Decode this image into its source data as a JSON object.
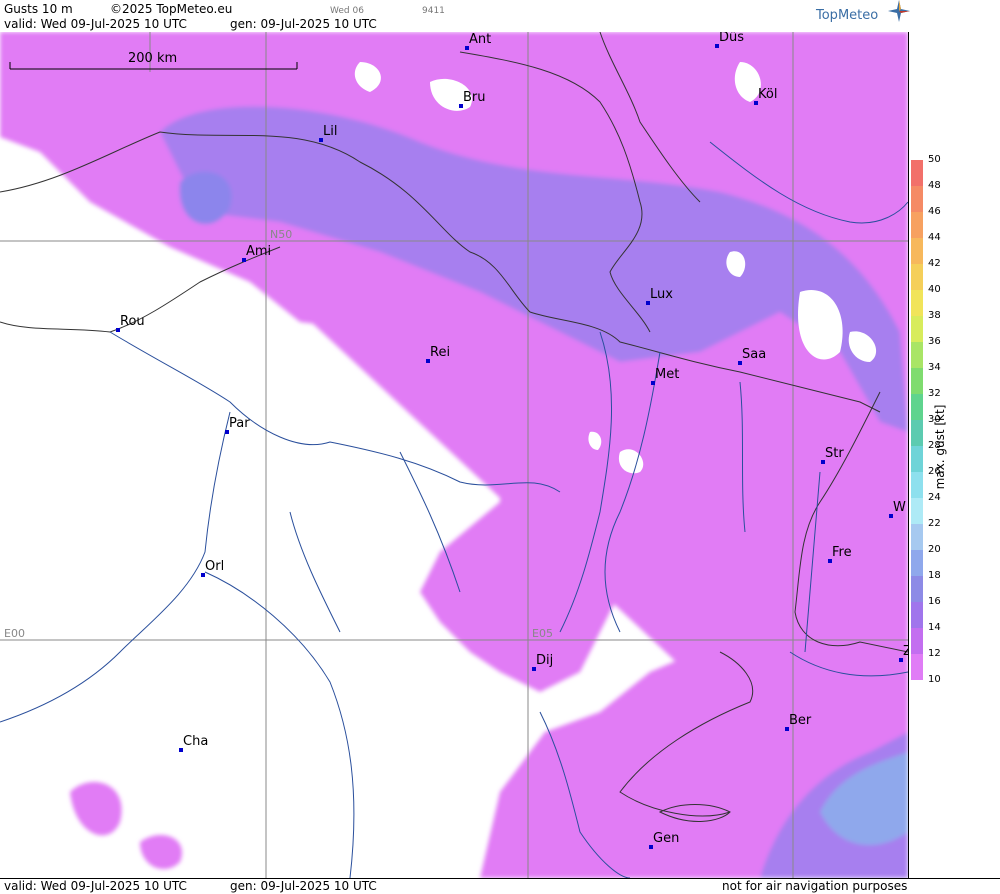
{
  "header": {
    "title": "Gusts 10 m",
    "copyright": "©2025 TopMeteo.eu",
    "run_day": "Wed 06",
    "code": "9411",
    "valid": "valid:  Wed  09-Jul-2025  10 UTC",
    "gen": "gen: 09-Jul-2025 10 UTC",
    "logo": "TopMeteo"
  },
  "scale_bar": {
    "label": "200 km"
  },
  "grid_labels": {
    "n50": "N50",
    "e00": "E00",
    "e05": "E05"
  },
  "cities": [
    {
      "name": "Ant"
    },
    {
      "name": "Düs"
    },
    {
      "name": "Bru"
    },
    {
      "name": "Köl"
    },
    {
      "name": "Lil"
    },
    {
      "name": "Ami"
    },
    {
      "name": "Lux"
    },
    {
      "name": "Rou"
    },
    {
      "name": "Saa"
    },
    {
      "name": "Rei"
    },
    {
      "name": "Met"
    },
    {
      "name": "Par"
    },
    {
      "name": "Str"
    },
    {
      "name": "W"
    },
    {
      "name": "Fre"
    },
    {
      "name": "Orl"
    },
    {
      "name": "Dij"
    },
    {
      "name": "Z"
    },
    {
      "name": "Ber"
    },
    {
      "name": "Cha"
    },
    {
      "name": "Gen"
    }
  ],
  "legend": {
    "title": "max. gust [kt]",
    "ticks": [
      "50",
      "48",
      "46",
      "44",
      "42",
      "40",
      "38",
      "36",
      "34",
      "32",
      "30",
      "28",
      "26",
      "24",
      "22",
      "20",
      "18",
      "16",
      "14",
      "12",
      "10"
    ],
    "colors": [
      "#f2706a",
      "#f58a65",
      "#f7a160",
      "#f7b85c",
      "#f5cf5a",
      "#f1e45a",
      "#d8ec5c",
      "#a9e566",
      "#7fdc6f",
      "#5fd48e",
      "#5ccbb0",
      "#6fd4d8",
      "#8ee0ee",
      "#aeeaf6",
      "#a6c9f0",
      "#8fa8ec",
      "#8d8ae6",
      "#a075ec",
      "#c36ef0",
      "#e07cf6"
    ]
  },
  "footer": {
    "valid": "valid:  Wed  09-Jul-2025  10 UTC",
    "gen": "gen: 09-Jul-2025 10 UTC",
    "notice": "not for air navigation purposes"
  }
}
